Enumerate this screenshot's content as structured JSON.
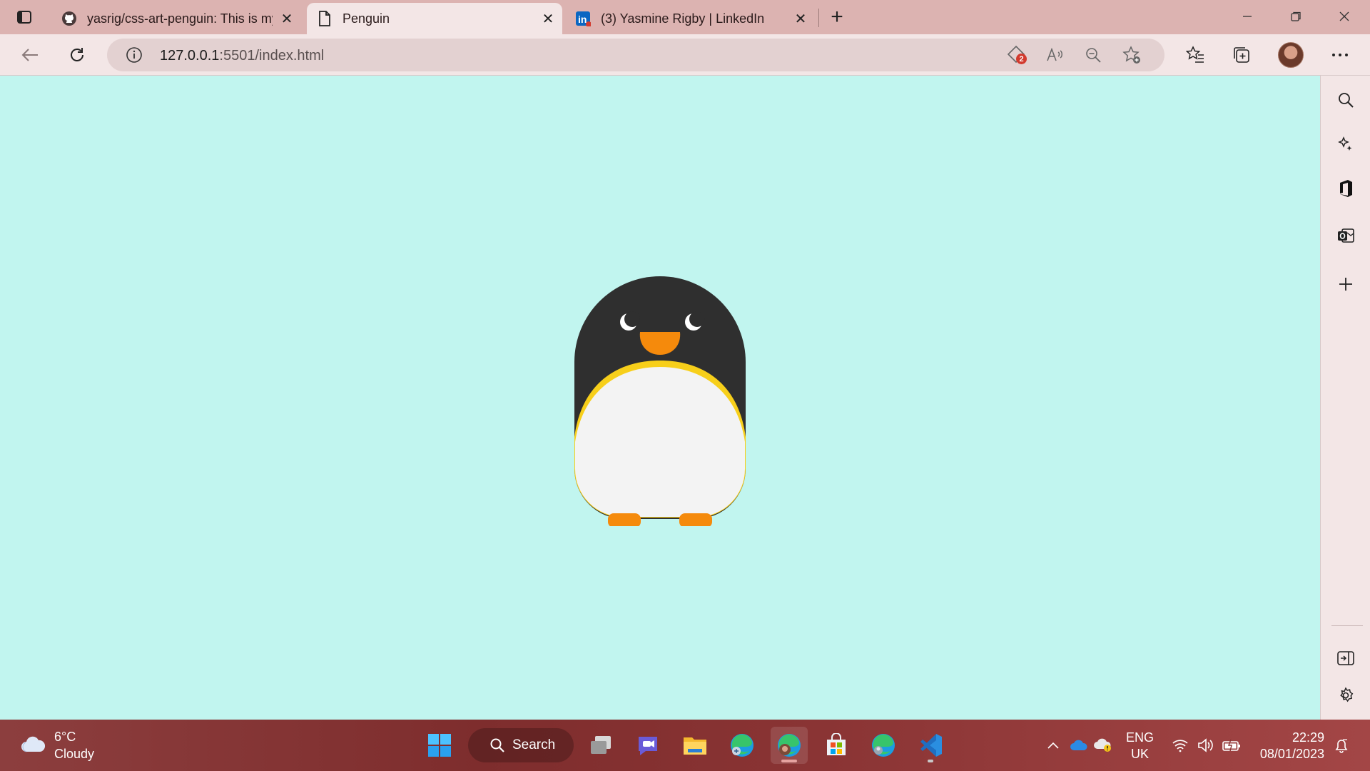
{
  "browser": {
    "tabs": [
      {
        "title": "yasrig/css-art-penguin: This is my",
        "icon": "github-icon",
        "active": false
      },
      {
        "title": "Penguin",
        "icon": "page-icon",
        "active": true
      },
      {
        "title": "(3) Yasmine Rigby | LinkedIn",
        "icon": "linkedin-icon",
        "active": false
      }
    ],
    "new_tab_label": "+",
    "address": {
      "host": "127.0.0.1",
      "path": ":5501/index.html"
    },
    "tracking_badge": "2"
  },
  "page": {
    "title": "Penguin",
    "colors": {
      "background": "#c1f5ef",
      "penguin_body": "#2f2f2f",
      "belly": "#f3f3f3",
      "belly_outline": "#f7cf1a",
      "beak": "#f58a0c",
      "feet": "#f58a0c"
    }
  },
  "taskbar": {
    "weather": {
      "temp": "6°C",
      "condition": "Cloudy"
    },
    "search_label": "Search",
    "language": {
      "line1": "ENG",
      "line2": "UK"
    },
    "clock": {
      "time": "22:29",
      "date": "08/01/2023"
    }
  }
}
